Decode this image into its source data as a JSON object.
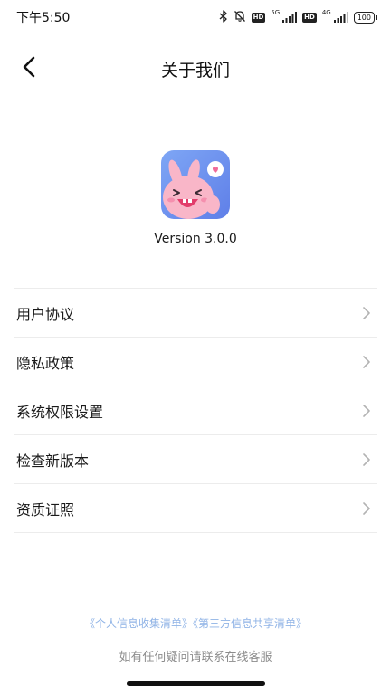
{
  "status_bar": {
    "time": "下午5:50",
    "hd_label": "HD",
    "network_1": "5G",
    "network_2": "4G",
    "battery": "100"
  },
  "nav": {
    "title": "关于我们"
  },
  "app": {
    "version": "Version 3.0.0",
    "logo_icon": "pink-bunny-logo-icon"
  },
  "menu": {
    "items": [
      {
        "label": "用户协议"
      },
      {
        "label": "隐私政策"
      },
      {
        "label": "系统权限设置"
      },
      {
        "label": "检查新版本"
      },
      {
        "label": "资质证照"
      }
    ]
  },
  "footer": {
    "link_personal_info": "《个人信息收集清单》",
    "link_third_party": "《第三方信息共享清单》",
    "note": "如有任何疑问请联系在线客服"
  },
  "colors": {
    "link": "#8fb3e6",
    "divider": "#ececec",
    "muted_text": "#8c8c8c"
  }
}
